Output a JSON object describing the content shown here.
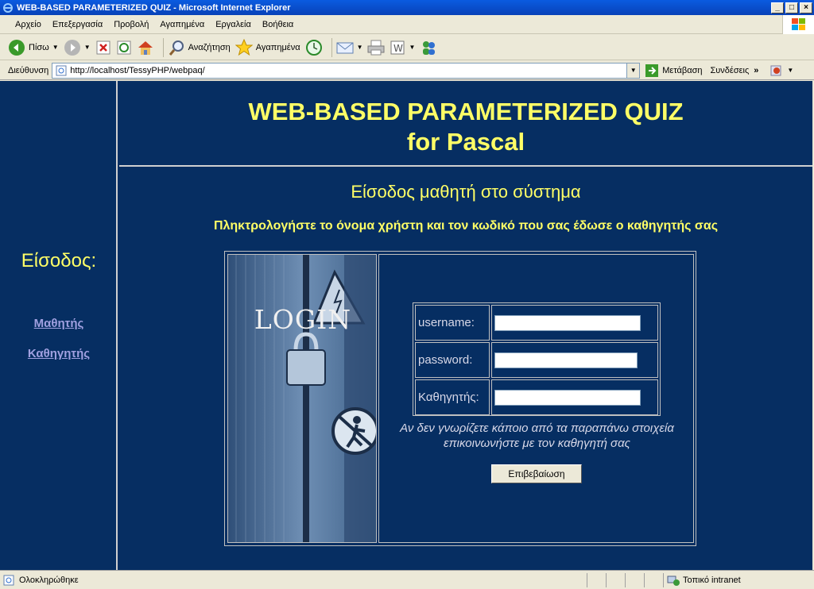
{
  "window": {
    "title": "WEB-BASED PARAMETERIZED QUIZ - Microsoft Internet Explorer"
  },
  "menu": [
    "Αρχείο",
    "Επεξεργασία",
    "Προβολή",
    "Αγαπημένα",
    "Εργαλεία",
    "Βοήθεια"
  ],
  "toolbar": {
    "back": "Πίσω",
    "search": "Αναζήτηση",
    "favorites": "Αγαπημένα"
  },
  "address": {
    "label": "Διεύθυνση",
    "url": "http://localhost/TessyPHP/webpaq/",
    "go": "Μετάβαση",
    "links": "Συνδέσεις"
  },
  "page": {
    "header_line1": "WEB-BASED PARAMETERIZED QUIZ",
    "header_line2": "for Pascal",
    "sidebar_title": "Είσοδος:",
    "sidebar_links": [
      "Μαθητής",
      "Καθηγητής"
    ],
    "section_title": "Είσοδος μαθητή στο σύστημα",
    "instructions": "Πληκτρολογήστε το όνομα χρήστη και τον κωδικό που σας έδωσε ο καθηγητής σας",
    "login_image_text": "LOGIN",
    "form": {
      "username_label": "username:",
      "username_value": "",
      "password_label": "password:",
      "password_value": "",
      "teacher_label": "Καθηγητής:",
      "teacher_value": ""
    },
    "note_line1": "Αν δεν γνωρίζετε κάποιο από τα παραπάνω στοιχεία",
    "note_line2": "επικοινωνήστε με τον καθηγητή σας",
    "submit": "Επιβεβαίωση"
  },
  "status": {
    "text": "Ολοκληρώθηκε",
    "zone": "Τοπικό intranet"
  },
  "colors": {
    "page_bg": "#062E62",
    "heading": "#FFFF66",
    "link": "#A0A0E0"
  }
}
